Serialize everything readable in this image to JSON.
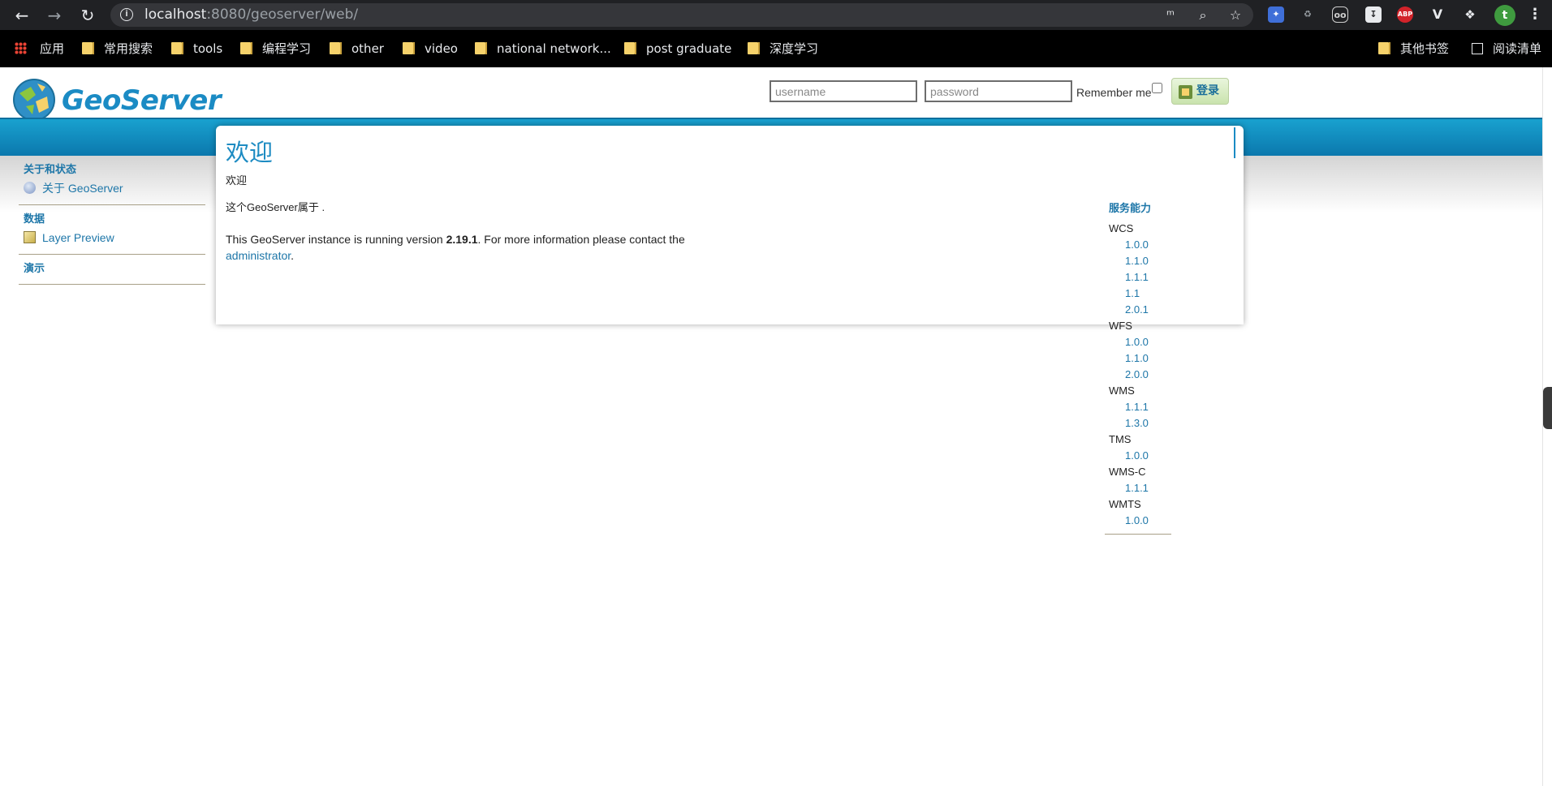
{
  "browser": {
    "url_host": "localhost",
    "url_rest": ":8080/geoserver/web/",
    "profile_initial": "t",
    "ext_abp": "ABP"
  },
  "bookmarks": [
    {
      "label": "应用",
      "type": "apps"
    },
    {
      "label": "常用搜索",
      "type": "folder"
    },
    {
      "label": "tools",
      "type": "folder"
    },
    {
      "label": "编程学习",
      "type": "folder"
    },
    {
      "label": "other",
      "type": "folder"
    },
    {
      "label": "video",
      "type": "folder"
    },
    {
      "label": "national network...",
      "type": "folder"
    },
    {
      "label": "post graduate",
      "type": "folder"
    },
    {
      "label": "深度学习",
      "type": "folder"
    },
    {
      "label": "其他书签",
      "type": "folder"
    },
    {
      "label": "阅读清单",
      "type": "reading-list"
    }
  ],
  "header": {
    "logo_text": "GeoServer",
    "username_placeholder": "username",
    "password_placeholder": "password",
    "remember_label": "Remember me",
    "login_label": "登录"
  },
  "sidebar": {
    "sections": [
      {
        "title": "关于和状态",
        "items": [
          {
            "label": "关于 GeoServer",
            "icon": "about-icon"
          }
        ]
      },
      {
        "title": "数据",
        "items": [
          {
            "label": "Layer Preview",
            "icon": "layer-preview-icon"
          }
        ]
      },
      {
        "title": "演示",
        "items": []
      }
    ]
  },
  "main": {
    "title": "欢迎",
    "subtitle": "欢迎",
    "owner_text": "这个GeoServer属于 .",
    "version_prefix": "This GeoServer instance is running version ",
    "version": "2.19.1",
    "version_suffix": ". For more information please contact the",
    "admin_link": "administrator",
    "period": "."
  },
  "capabilities": {
    "title": "服务能力",
    "services": [
      {
        "name": "WCS",
        "versions": [
          "1.0.0",
          "1.1.0",
          "1.1.1",
          "1.1",
          "2.0.1"
        ]
      },
      {
        "name": "WFS",
        "versions": [
          "1.0.0",
          "1.1.0",
          "2.0.0"
        ]
      },
      {
        "name": "WMS",
        "versions": [
          "1.1.1",
          "1.3.0"
        ]
      },
      {
        "name": "TMS",
        "versions": [
          "1.0.0"
        ]
      },
      {
        "name": "WMS-C",
        "versions": [
          "1.1.1"
        ]
      },
      {
        "name": "WMTS",
        "versions": [
          "1.0.0"
        ]
      }
    ]
  },
  "colors": {
    "accent": "#1d76a8",
    "bluebar": "#0b78ad",
    "chrome_bg": "#202124"
  }
}
